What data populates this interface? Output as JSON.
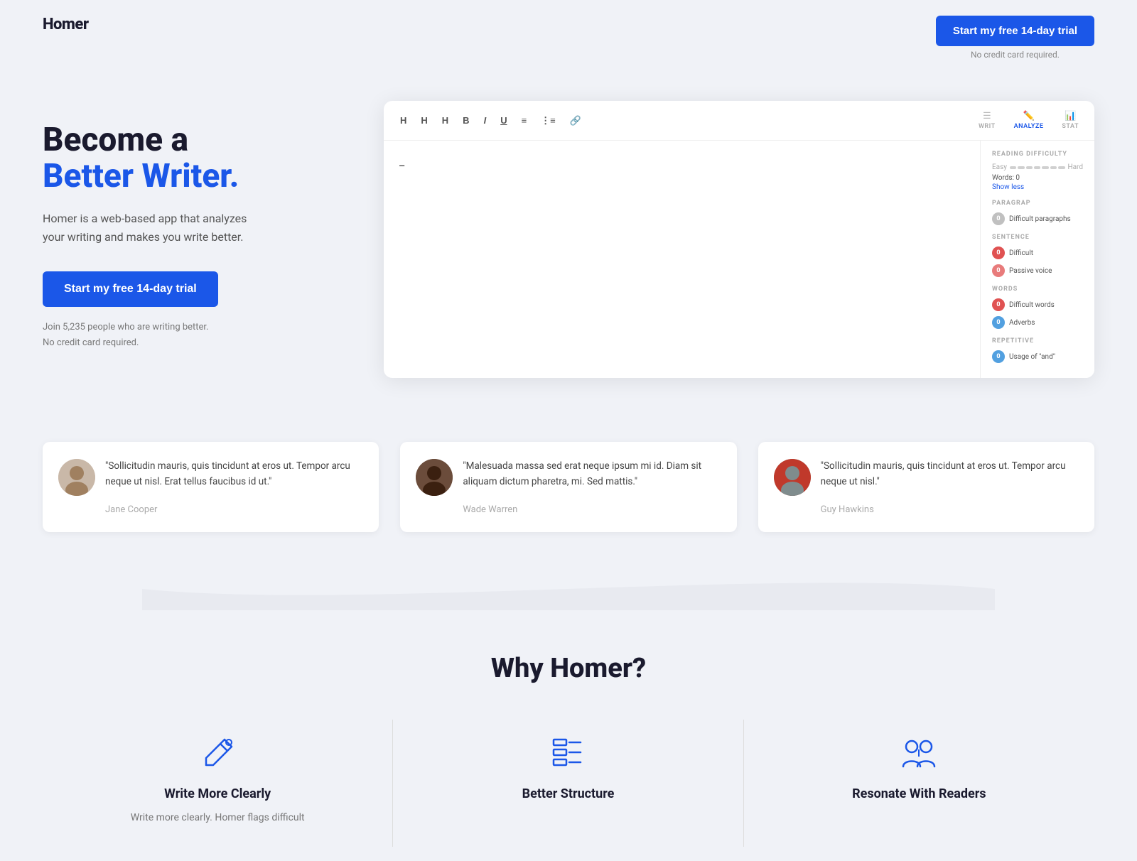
{
  "header": {
    "logo": "Homer",
    "cta_label": "Start my free 14-day trial",
    "no_cc": "No credit card required."
  },
  "hero": {
    "title_line1": "Become a",
    "title_line2": "Better Writer.",
    "subtitle": "Homer is a web-based app that analyzes\nyour writing and makes you write better.",
    "cta_label": "Start my free 14-day trial",
    "join_line1": "Join 5,235 people who are writing better.",
    "join_line2": "No credit card required."
  },
  "editor": {
    "tabs": {
      "write": "WRIT",
      "analyze": "ANALYZE",
      "stat": "STAT"
    },
    "cursor": "_",
    "sidebar": {
      "reading_difficulty_label": "READING DIFFICULTY",
      "easy": "Easy",
      "hard": "Hard",
      "words_label": "Words: 0",
      "show_less": "Show less",
      "paragrap_label": "PARAGRAP",
      "sentence_label": "SENTENCE",
      "words_section_label": "WORDS",
      "repetitive_label": "REPETITIVE",
      "stats": [
        {
          "count": "0",
          "label": "Difficult paragraphs",
          "color": "gray"
        },
        {
          "count": "0",
          "label": "Difficult",
          "color": "red"
        },
        {
          "count": "0",
          "label": "Passive voice",
          "color": "pink"
        },
        {
          "count": "0",
          "label": "Difficult words",
          "color": "red"
        },
        {
          "count": "0",
          "label": "Adverbs",
          "color": "blue"
        },
        {
          "count": "0",
          "label": "Usage of \"and\"",
          "color": "blue"
        }
      ]
    }
  },
  "testimonials": [
    {
      "id": 1,
      "quote": "\"Sollicitudin mauris, quis tincidunt at eros ut. Tempor arcu neque ut nisl. Erat tellus faucibus id ut.\"",
      "name": "Jane Cooper",
      "avatar_emoji": "👩"
    },
    {
      "id": 2,
      "quote": "\"Malesuada massa sed erat neque ipsum mi id. Diam sit aliquam dictum pharetra, mi. Sed mattis.\"",
      "name": "Wade Warren",
      "avatar_emoji": "🧑"
    },
    {
      "id": 3,
      "quote": "\"Sollicitudin mauris, quis tincidunt at eros ut. Tempor arcu neque ut nisl.\"",
      "name": "Guy Hawkins",
      "avatar_emoji": "👨"
    }
  ],
  "why": {
    "title": "Why Homer?",
    "features": [
      {
        "name": "write-more-clearly",
        "title": "Write More Clearly",
        "desc": "Write more clearly. Homer flags difficult"
      },
      {
        "name": "better-structure",
        "title": "Better Structure",
        "desc": ""
      },
      {
        "name": "resonate-with-readers",
        "title": "Resonate With Readers",
        "desc": ""
      }
    ]
  }
}
